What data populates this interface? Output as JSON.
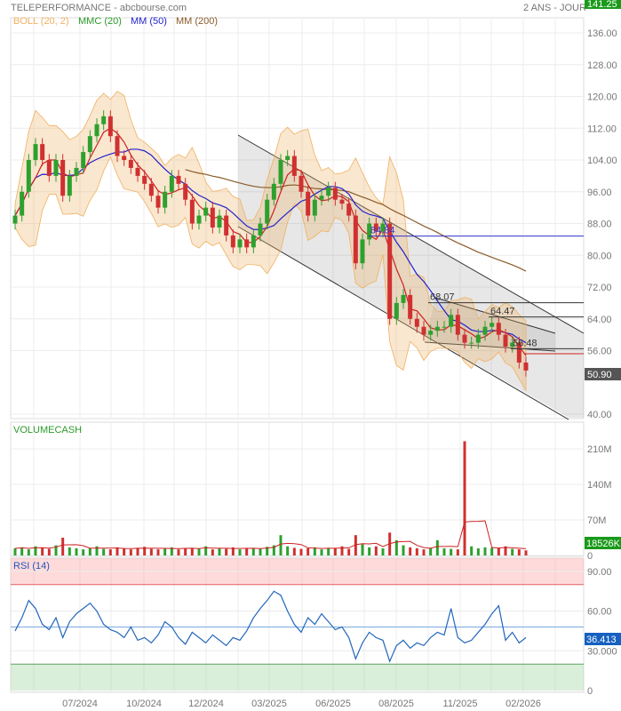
{
  "header": {
    "title": "TELEPERFORMANCE - abcbourse.com",
    "period": "2 ANS - JOUR"
  },
  "legend": [
    {
      "label": "BOLL (20, 2)",
      "color": "#f0b060"
    },
    {
      "label": "MMC (20)",
      "color": "#2a9a2a"
    },
    {
      "label": "MM (50)",
      "color": "#2222cc"
    },
    {
      "label": "MM (200)",
      "color": "#8a5a2a"
    }
  ],
  "chart_data": [
    {
      "type": "candlestick",
      "title": "TELEPERFORMANCE",
      "ylim": [
        38,
        140
      ],
      "y_ticks": [
        "136.00",
        "128.00",
        "120.00",
        "112.00",
        "104.00",
        "96.00",
        "88.00",
        "80.00",
        "72.00",
        "64.00",
        "56.00",
        "40.00"
      ],
      "y_tick_values": [
        136,
        128,
        120,
        112,
        104,
        96,
        88,
        80,
        72,
        64,
        56,
        40
      ],
      "x_tick_labels": [
        "07/2024",
        "10/2024",
        "12/2024",
        "03/2025",
        "06/2025",
        "08/2025",
        "11/2025",
        "02/2026"
      ],
      "closes": [
        90,
        96,
        104,
        108,
        104,
        100,
        104,
        95,
        100,
        102,
        106,
        110,
        113,
        115,
        110,
        105,
        104,
        102,
        100,
        98,
        95,
        92,
        96,
        100,
        98,
        94,
        88,
        90,
        92,
        87,
        90,
        85,
        82,
        84,
        82,
        85,
        88,
        94,
        98,
        104,
        105,
        100,
        96,
        90,
        94,
        95,
        97,
        94,
        93,
        90,
        78,
        84,
        88,
        86,
        88,
        64,
        68,
        70,
        64,
        62,
        60,
        61,
        62,
        62,
        65,
        60,
        58,
        58,
        60,
        62,
        63,
        60,
        57,
        58,
        53,
        51
      ],
      "last_price": "50.90",
      "top_label": "141.25",
      "annotations": [
        "84.84",
        "68.07",
        "64.47",
        "56.48"
      ],
      "annotation_values": [
        84.84,
        68.07,
        64.47,
        56.48
      ],
      "colors": {
        "up": "#2ea02e",
        "down": "#d03030"
      }
    },
    {
      "type": "bar",
      "title": "VOLUMECASH",
      "y_ticks": [
        "210M",
        "140M",
        "70M",
        "0"
      ],
      "y_tick_values": [
        210,
        140,
        70,
        0
      ],
      "values_m": [
        14,
        16,
        12,
        18,
        15,
        13,
        20,
        35,
        16,
        14,
        12,
        15,
        18,
        13,
        12,
        16,
        14,
        12,
        15,
        17,
        13,
        12,
        14,
        16,
        12,
        14,
        15,
        13,
        18,
        12,
        14,
        13,
        16,
        12,
        15,
        14,
        13,
        17,
        20,
        40,
        18,
        15,
        13,
        14,
        16,
        12,
        15,
        14,
        18,
        13,
        40,
        22,
        16,
        18,
        14,
        45,
        30,
        20,
        16,
        14,
        12,
        15,
        30,
        14,
        13,
        12,
        225,
        18,
        14,
        16,
        15,
        14,
        18,
        13,
        12,
        10
      ],
      "last_value": "18526K"
    },
    {
      "type": "line",
      "title": "RSI (14)",
      "y_ticks": [
        "90.00",
        "60.00",
        "30.000",
        "0"
      ],
      "y_tick_values": [
        90,
        60,
        30,
        0
      ],
      "ylim": [
        0,
        100
      ],
      "values": [
        45,
        55,
        68,
        62,
        50,
        46,
        55,
        40,
        52,
        58,
        62,
        66,
        60,
        50,
        46,
        44,
        40,
        48,
        38,
        40,
        36,
        42,
        52,
        48,
        40,
        35,
        44,
        40,
        36,
        42,
        38,
        34,
        40,
        38,
        45,
        55,
        62,
        68,
        75,
        72,
        60,
        50,
        44,
        55,
        50,
        58,
        52,
        46,
        48,
        40,
        24,
        36,
        44,
        40,
        38,
        22,
        34,
        38,
        32,
        36,
        34,
        40,
        44,
        42,
        62,
        40,
        36,
        38,
        44,
        50,
        58,
        64,
        38,
        44,
        36,
        40
      ],
      "last_value": "36.413",
      "overbought": 80,
      "oversold": 20
    }
  ]
}
